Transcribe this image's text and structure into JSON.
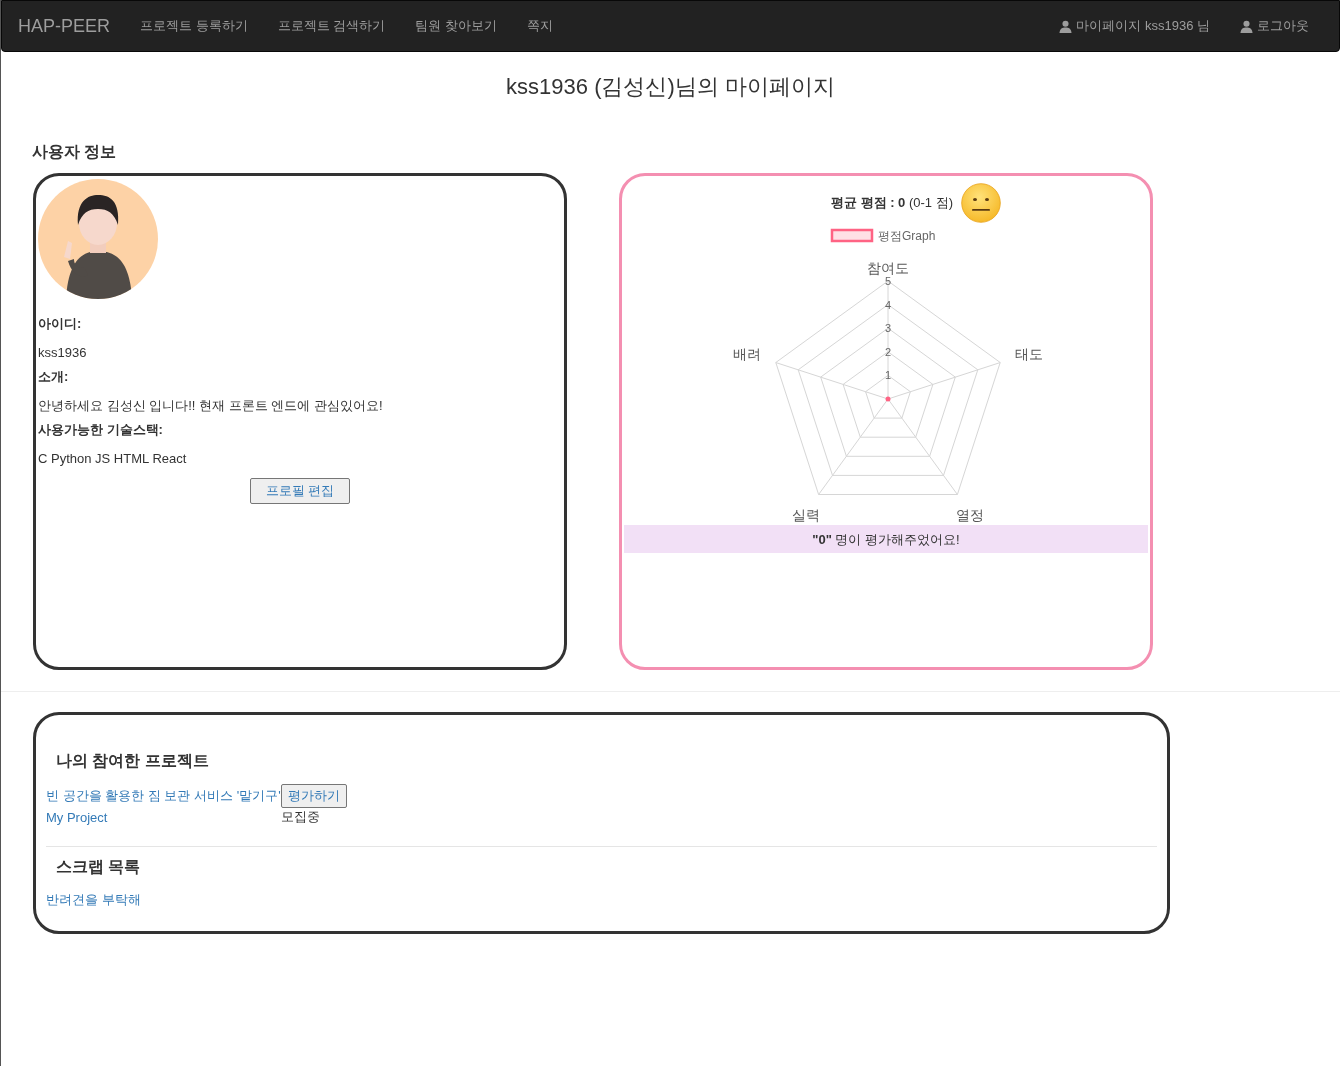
{
  "navbar": {
    "brand": "HAP-PEER",
    "links": [
      "프로젝트 등록하기",
      "프로젝트 검색하기",
      "팀원 찾아보기",
      "쪽지"
    ],
    "right_links": [
      "마이페이지 kss1936 님",
      "로그아웃"
    ]
  },
  "page_title": "kss1936 (김성신)님의 마이페이지",
  "user_section": {
    "heading": "사용자 정보",
    "fields": [
      {
        "label": "아이디:",
        "value": "kss1936"
      },
      {
        "label": "소개:",
        "value": "안녕하세요 김성신 입니다!! 현재 프론트 엔드에 관심있어요!"
      },
      {
        "label": "사용가능한 기술스택:",
        "value": "C Python JS HTML React"
      }
    ],
    "edit_button": "프로필 편집"
  },
  "rating": {
    "summary": "**평균 평점 : 0** (0-1 점)",
    "radar": {
      "legend": "평점Graph",
      "axes": [
        "참여도",
        "태도",
        "열정",
        "실력",
        "배려"
      ],
      "scale_labels": [
        "5",
        "4",
        "3",
        "2",
        "1"
      ]
    },
    "count_note": "**\"0\"** 명이 평가해주었어요!"
  },
  "projects": {
    "heading": "나의 참여한 프로젝트",
    "items": [
      {
        "title": "빈 공간을 활용한 짐 보관 서비스 '맡기구'",
        "kind": "button",
        "action": "평가하기"
      },
      {
        "title": "My Project",
        "kind": "status",
        "action": "모집중"
      }
    ]
  },
  "scraps": {
    "heading": "스크랩 목록",
    "items": [
      "반려견을 부탁해"
    ]
  }
}
